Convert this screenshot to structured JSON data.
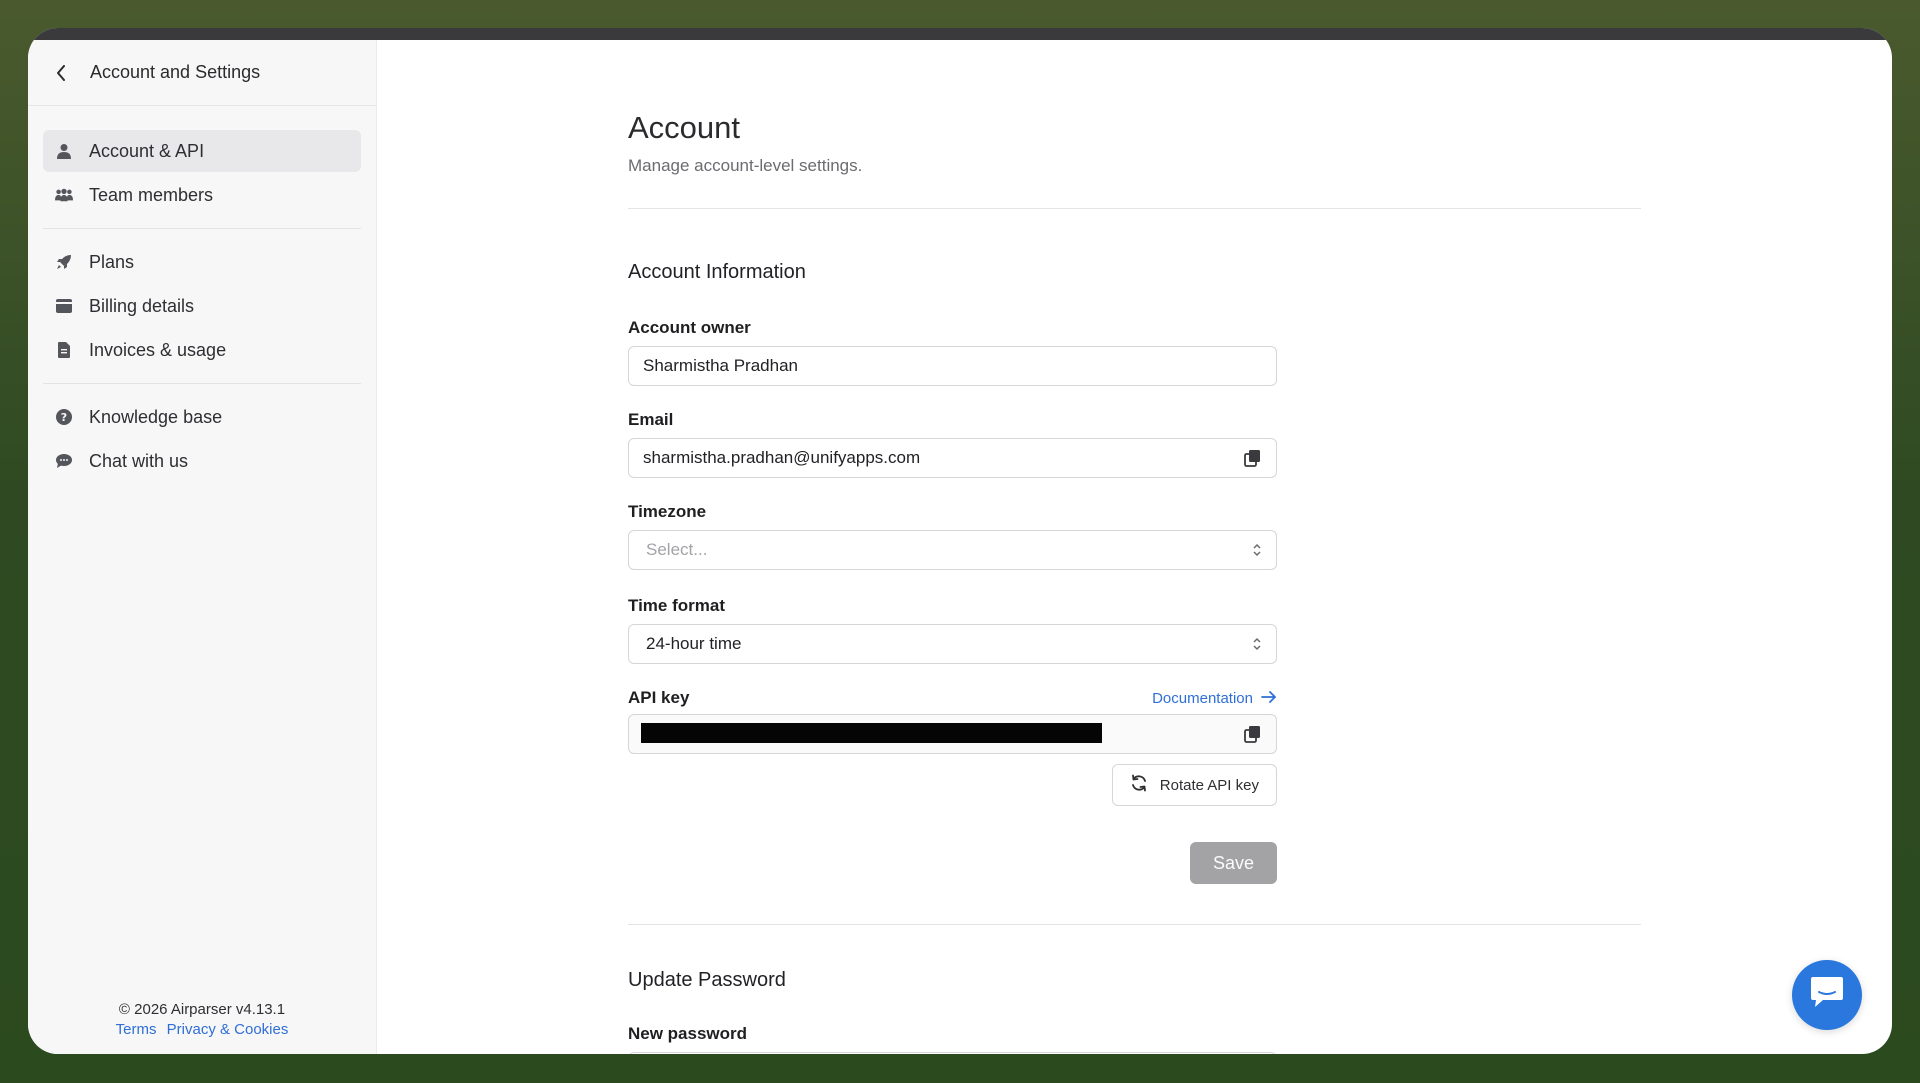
{
  "sidebar": {
    "title": "Account and Settings",
    "groups": [
      [
        {
          "label": "Account & API",
          "icon": "user-icon",
          "active": true
        },
        {
          "label": "Team members",
          "icon": "team-icon"
        }
      ],
      [
        {
          "label": "Plans",
          "icon": "rocket-icon"
        },
        {
          "label": "Billing details",
          "icon": "wallet-icon"
        },
        {
          "label": "Invoices & usage",
          "icon": "file-icon"
        }
      ],
      [
        {
          "label": "Knowledge base",
          "icon": "question-circle-icon"
        },
        {
          "label": "Chat with us",
          "icon": "chat-icon"
        }
      ]
    ],
    "footer": {
      "copyright": "© 2026 Airparser v4.13.1",
      "terms": "Terms",
      "privacy": "Privacy & Cookies"
    }
  },
  "main": {
    "title": "Account",
    "subtitle": "Manage account-level settings.",
    "account_info": {
      "heading": "Account Information",
      "owner_label": "Account owner",
      "owner_value": "Sharmistha Pradhan",
      "email_label": "Email",
      "email_value": "sharmistha.pradhan@unifyapps.com",
      "timezone_label": "Timezone",
      "timezone_placeholder": "Select...",
      "timeformat_label": "Time format",
      "timeformat_value": "24-hour time",
      "apikey_label": "API key",
      "documentation_link": "Documentation",
      "rotate_button": "Rotate API key",
      "save_button": "Save"
    },
    "update_password": {
      "heading": "Update Password",
      "new_password_label": "New password"
    }
  },
  "colors": {
    "accent": "#2f6fd6",
    "chat_button": "#2a78dd",
    "save_disabled": "#a3a3a6"
  }
}
